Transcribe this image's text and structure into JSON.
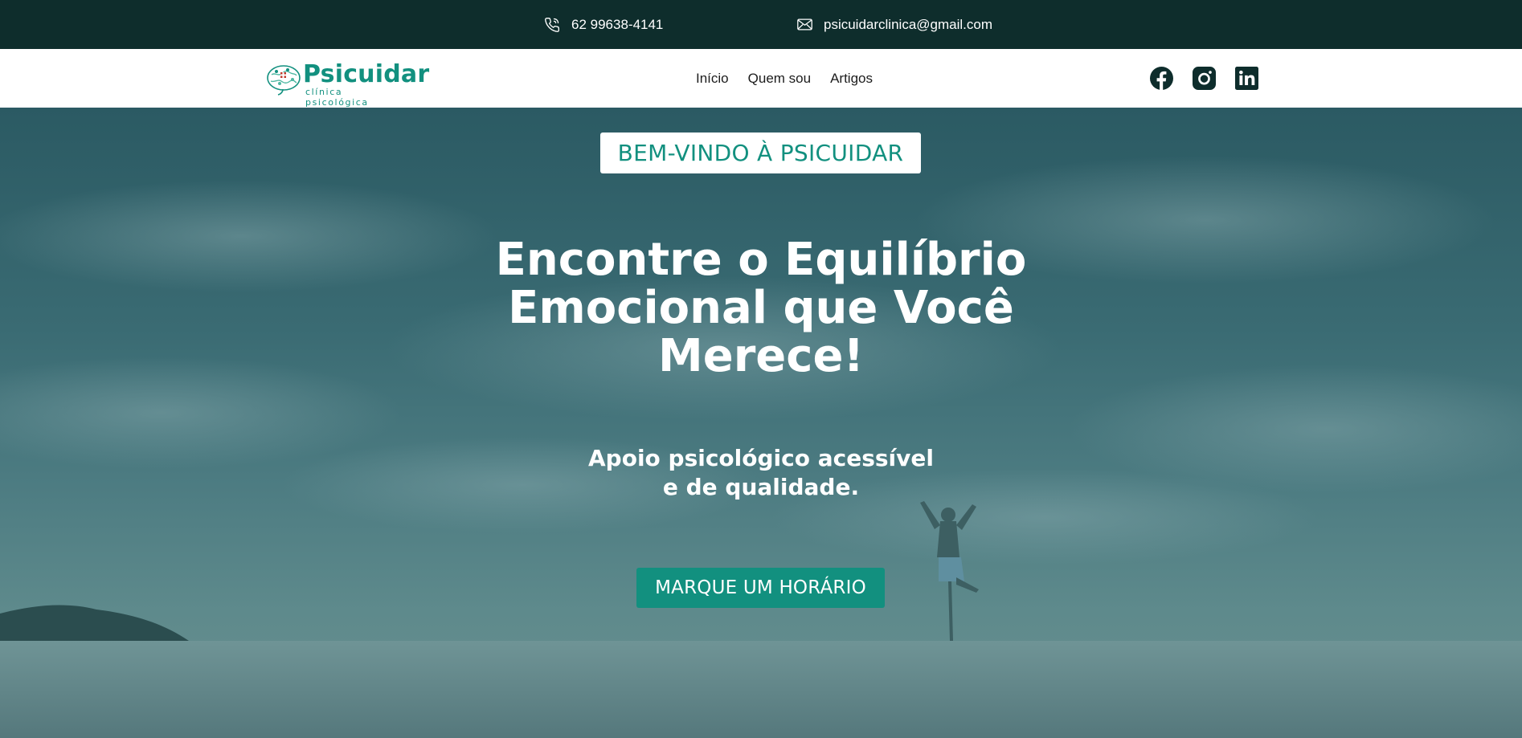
{
  "topbar": {
    "phone": "62 99638-4141",
    "email": "psicuidarclinica@gmail.com",
    "phone_icon": "phone-icon",
    "email_icon": "mail-icon"
  },
  "header": {
    "logo_name": "Psicuidar",
    "logo_tagline": "clínica psicológica",
    "nav": [
      "Início",
      "Quem sou",
      "Artigos"
    ],
    "socials": [
      "facebook-icon",
      "instagram-icon",
      "linkedin-icon"
    ]
  },
  "hero": {
    "welcome": "BEM-VINDO À PSICUIDAR",
    "headline": "Encontre o Equilíbrio Emocional que Você Merece!",
    "subline_1": "Apoio psicológico acessível",
    "subline_2": "e de qualidade.",
    "cta": "MARQUE UM HORÁRIO"
  },
  "colors": {
    "topbar_bg": "#0e2d2c",
    "accent": "#12907f",
    "hero_overlay": "#2b5a63"
  }
}
